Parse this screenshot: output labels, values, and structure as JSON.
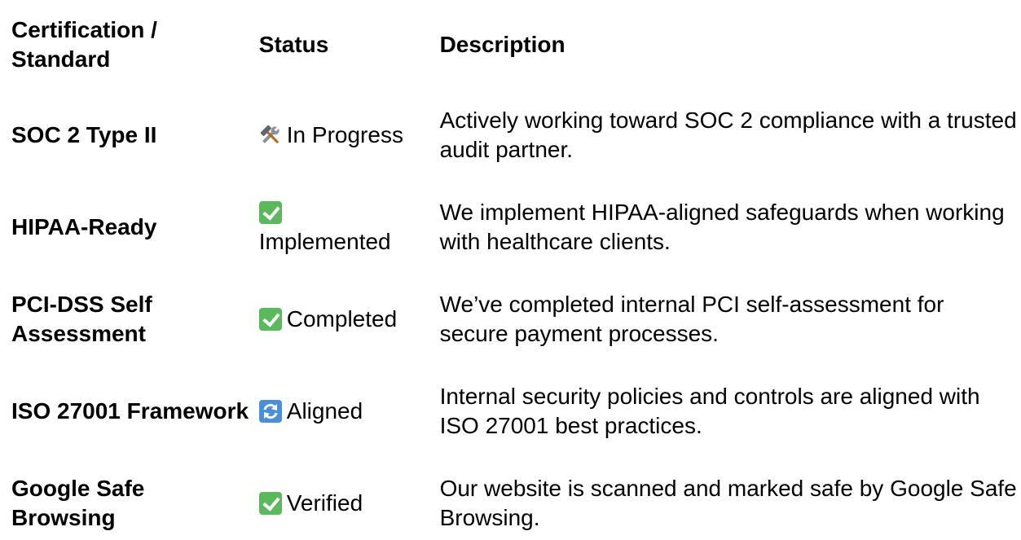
{
  "table": {
    "headers": {
      "certification": "Certification / Standard",
      "status": "Status",
      "description": "Description"
    },
    "rows": [
      {
        "certification": "SOC 2 Type II",
        "status_icon": "tools-icon",
        "status": "In Progress",
        "description": "Actively working toward SOC 2 compliance with a trusted audit partner."
      },
      {
        "certification": "HIPAA-Ready",
        "status_icon": "check-mark-icon",
        "status": "Implemented",
        "description": "We implement HIPAA-aligned safeguards when working with healthcare clients."
      },
      {
        "certification": "PCI-DSS Self Assessment",
        "status_icon": "check-mark-icon",
        "status": "Completed",
        "description": "We’ve completed internal PCI self-assessment for secure payment processes."
      },
      {
        "certification": "ISO 27001 Framework",
        "status_icon": "cycle-arrows-icon",
        "status": "Aligned",
        "description": "Internal security policies and controls are aligned with ISO 27001 best practices."
      },
      {
        "certification": "Google Safe Browsing",
        "status_icon": "check-mark-icon",
        "status": "Verified",
        "description": "Our website is scanned and marked safe by Google Safe Browsing."
      }
    ]
  },
  "colors": {
    "check_green": "#5cb85c",
    "cycle_blue": "#4a90d9",
    "text": "#000000",
    "background": "#ffffff"
  }
}
